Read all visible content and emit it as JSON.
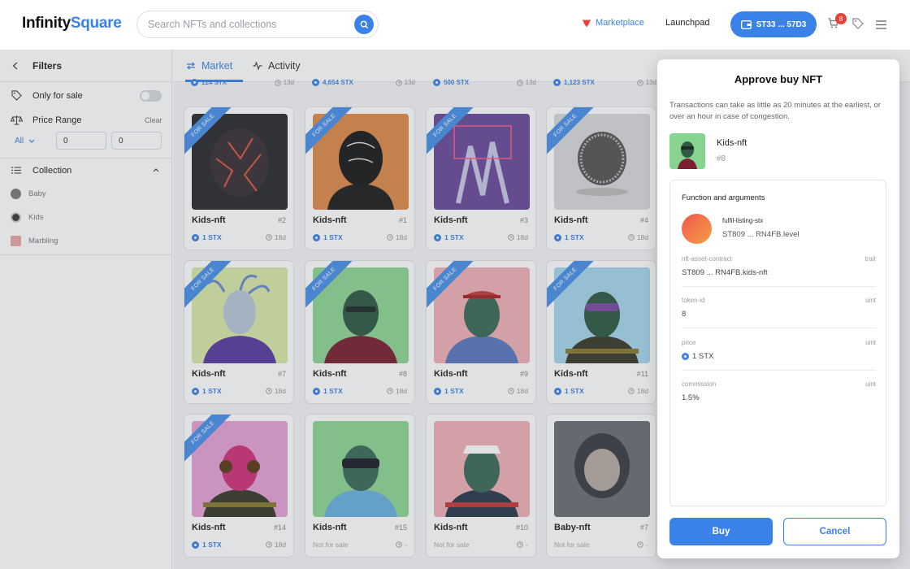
{
  "brand": {
    "part1": "Infinity",
    "part2": "Square"
  },
  "search": {
    "placeholder": "Search NFTs and collections"
  },
  "nav": {
    "marketplace": "Marketplace",
    "launchpad": "Launchpad"
  },
  "wallet": {
    "label": "ST33 ... 57D3"
  },
  "cart": {
    "count": "8"
  },
  "filters": {
    "title": "Filters",
    "only_for_sale": "Only for sale",
    "only_for_sale_enabled": false,
    "price_range": "Price Range",
    "clear": "Clear",
    "currency": "All",
    "min": "0",
    "max": "0",
    "collection": "Collection",
    "collections": [
      {
        "name": "Baby"
      },
      {
        "name": "Kids"
      },
      {
        "name": "Marbling"
      }
    ]
  },
  "tabs": {
    "market": "Market",
    "activity": "Activity"
  },
  "top_strip": [
    {
      "price": "124 STX",
      "age": "13d"
    },
    {
      "price": "4,654 STX",
      "age": "13d"
    },
    {
      "price": "500 STX",
      "age": "13d"
    },
    {
      "price": "1,123 STX",
      "age": "13d"
    }
  ],
  "ribbon": "FOR SALE",
  "cards": [
    {
      "name": "Kids-nft",
      "num": "#2",
      "price": "1 STX",
      "age": "18d",
      "for_sale": true,
      "bg": "#2a2a2c"
    },
    {
      "name": "Kids-nft",
      "num": "#1",
      "price": "1 STX",
      "age": "18d",
      "for_sale": true,
      "bg": "#e08a4a"
    },
    {
      "name": "Kids-nft",
      "num": "#3",
      "price": "1 STX",
      "age": "18d",
      "for_sale": true,
      "bg": "#6a4a9a"
    },
    {
      "name": "Kids-nft",
      "num": "#4",
      "price": "1 STX",
      "age": "18d",
      "for_sale": true,
      "bg": "#d8d8dc"
    },
    {
      "name": "Kids-nft",
      "num": "#7",
      "price": "1 STX",
      "age": "18d",
      "for_sale": true,
      "bg": "#d8e8a8"
    },
    {
      "name": "Kids-nft",
      "num": "#8",
      "price": "1 STX",
      "age": "18d",
      "for_sale": true,
      "bg": "#8fd694"
    },
    {
      "name": "Kids-nft",
      "num": "#9",
      "price": "1 STX",
      "age": "18d",
      "for_sale": true,
      "bg": "#efb0b6"
    },
    {
      "name": "Kids-nft",
      "num": "#11",
      "price": "1 STX",
      "age": "18d",
      "for_sale": true,
      "bg": "#a8d6ee"
    },
    {
      "name": "Kids-nft",
      "num": "#14",
      "price": "1 STX",
      "age": "18d",
      "for_sale": true,
      "bg": "#e6a0d6"
    },
    {
      "name": "Kids-nft",
      "num": "#15",
      "price": "",
      "age": "-",
      "for_sale": false,
      "not_for_sale": "Not for sale",
      "bg": "#8fd694"
    },
    {
      "name": "Kids-nft",
      "num": "#10",
      "price": "",
      "age": "-",
      "for_sale": false,
      "not_for_sale": "Not for sale",
      "bg": "#efb0b6"
    },
    {
      "name": "Baby-nft",
      "num": "#7",
      "price": "",
      "age": "-",
      "for_sale": false,
      "not_for_sale": "Not for sale",
      "bg": "#6a6e74"
    }
  ],
  "modal": {
    "title": "Approve buy NFT",
    "description": "Transactions can take as little as 20 minutes at the earliest, or over an hour in case of congestion.",
    "nft_name": "Kids-nft",
    "nft_num": "#8",
    "fn_title": "Function and arguments",
    "fn_name": "fulfil-listing-stx",
    "fn_contract": "ST809 ... RN4FB.level",
    "args": [
      {
        "label": "nft-asset-contract",
        "type": "trait",
        "value": "ST809 ... RN4FB.kids-nft"
      },
      {
        "label": "token-id",
        "type": "uint",
        "value": "8"
      },
      {
        "label": "price",
        "type": "uint",
        "value": "1 STX"
      },
      {
        "label": "commission",
        "type": "uint",
        "value": "1.5%"
      }
    ],
    "buy": "Buy",
    "cancel": "Cancel"
  },
  "colors": {
    "accent": "#3b82e8",
    "badge": "#e8403b"
  }
}
